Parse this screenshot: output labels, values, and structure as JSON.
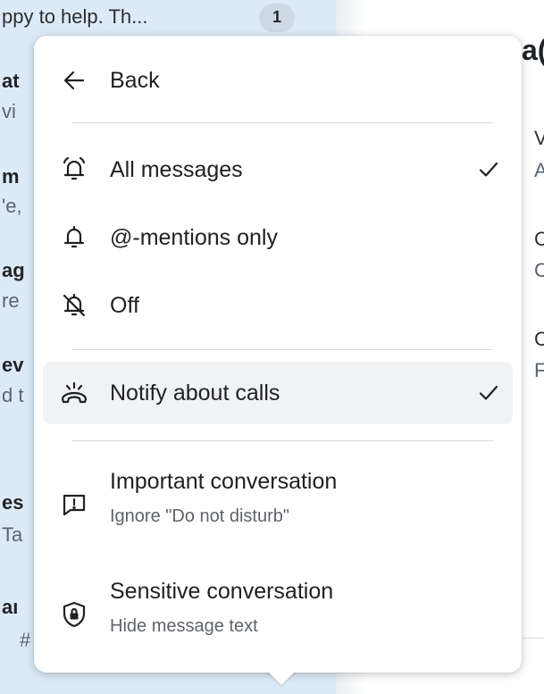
{
  "background": {
    "list_rows": [
      {
        "text": "ppy to help. Th...",
        "style": "normal"
      },
      {
        "text": "at",
        "style": "bold"
      },
      {
        "text": "vi",
        "style": "muted"
      },
      {
        "text": "m",
        "style": "bold"
      },
      {
        "text": "'e,",
        "style": "muted"
      },
      {
        "text": "ag",
        "style": "bold"
      },
      {
        "text": "re",
        "style": "muted"
      },
      {
        "text": "ev",
        "style": "bold"
      },
      {
        "text": "d t",
        "style": "muted"
      },
      {
        "text": "es",
        "style": "bold"
      },
      {
        "text": "Ta",
        "style": "muted"
      },
      {
        "text": "aı",
        "style": "bold"
      },
      {
        "text": "#",
        "style": "muted"
      }
    ],
    "unread_count": "1",
    "right_fragments": [
      "a(",
      "V",
      "A",
      "C",
      "C",
      "C",
      "F"
    ]
  },
  "menu": {
    "back_label": "Back",
    "items": [
      {
        "label": "All messages",
        "icon": "bell-ringing-icon",
        "checked": true
      },
      {
        "label": "@-mentions only",
        "icon": "bell-icon",
        "checked": false
      },
      {
        "label": "Off",
        "icon": "bell-off-icon",
        "checked": false
      }
    ],
    "calls": {
      "label": "Notify about calls",
      "icon": "phone-ringing-icon",
      "checked": true
    },
    "important": {
      "label": "Important conversation",
      "sublabel": "Ignore \"Do not disturb\"",
      "icon": "message-exclamation-icon"
    },
    "sensitive": {
      "label": "Sensitive conversation",
      "sublabel": "Hide message text",
      "icon": "shield-lock-icon"
    }
  }
}
